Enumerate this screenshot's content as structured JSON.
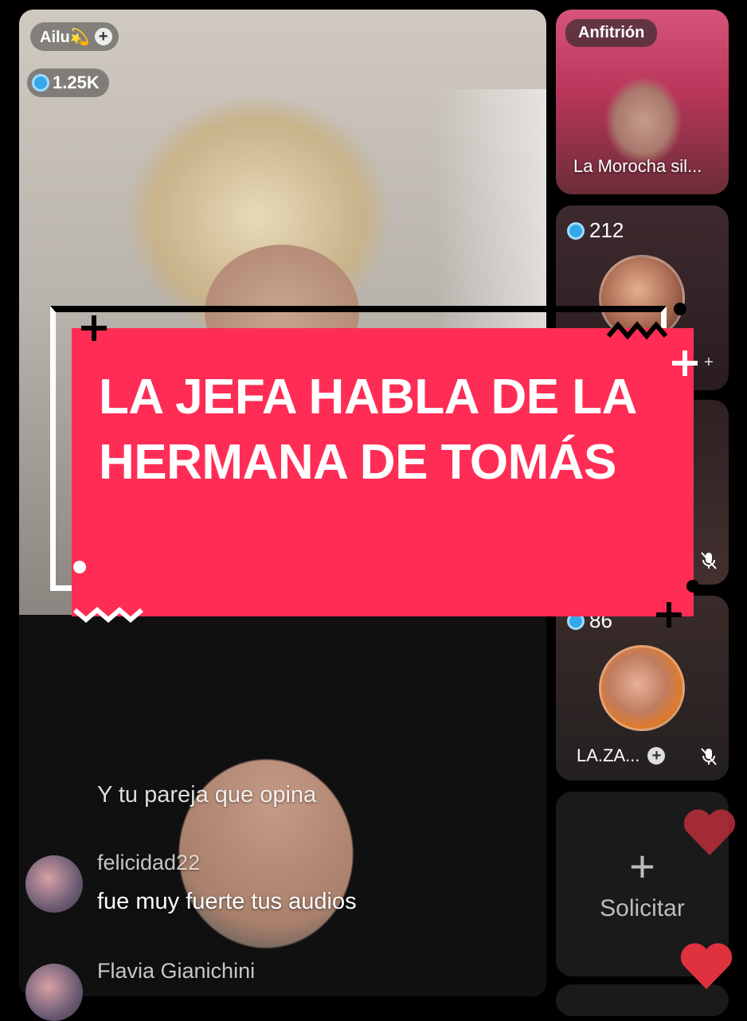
{
  "host": {
    "name": "Ailu💫",
    "coins": "1.25K"
  },
  "overlay": {
    "title": "LA JEFA HABLA DE LA HERMANA DE TOMÁS"
  },
  "comments": [
    {
      "user": "",
      "text": "Y tu pareja que opina"
    },
    {
      "user": "felicidad22",
      "text": "fue muy fuerte tus audios"
    },
    {
      "user": "Flavia Gianichini",
      "text": ""
    }
  ],
  "guests": {
    "host_badge": "Anfitrión",
    "host_name": "La Morocha sil...",
    "guest2_coins": "212",
    "guest4_coins": "86",
    "guest4_name": "LA.ZA...",
    "request_label": "Solicitar"
  },
  "colors": {
    "banner": "#ff2d55",
    "heart": "#e0313f"
  }
}
